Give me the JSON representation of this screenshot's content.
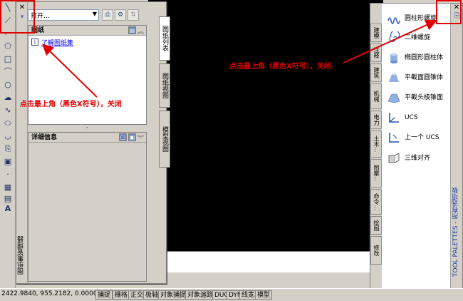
{
  "sheet_set_manager": {
    "title": "图纸集管理器",
    "open_combo": "打开...",
    "sheets_header": "图纸",
    "learn_link": "了解图纸集",
    "details_header": "详细信息",
    "tabs": [
      "图纸列表",
      "图纸视图",
      "模型视图"
    ]
  },
  "tool_palette": {
    "title": "TOOL PALETTES - 所有选项板",
    "tabs": [
      "建模",
      "注释",
      "建筑",
      "机械",
      "电力",
      "土木...",
      "图案...",
      "命令...",
      "绘图",
      "修改"
    ],
    "items": [
      {
        "label": "圆柱形螺旋",
        "icon": "helix-icon"
      },
      {
        "label": "二维螺旋",
        "icon": "spiral-icon"
      },
      {
        "label": "椭圆形圆柱体",
        "icon": "elliptical-cylinder-icon"
      },
      {
        "label": "平截面圆锥体",
        "icon": "frustum-cone-icon"
      },
      {
        "label": "平截头棱锥面",
        "icon": "frustum-pyramid-icon"
      },
      {
        "label": "UCS",
        "icon": "ucs-icon"
      },
      {
        "label": "上一个 UCS",
        "icon": "ucs-previous-icon"
      },
      {
        "label": "三维对齐",
        "icon": "3d-align-icon"
      }
    ]
  },
  "annotations": {
    "left": "点击最上角（黑色X符号），关闭",
    "right": "点击最上角（黑色X符号），关闭",
    "color": "#e00000"
  },
  "statusbar": {
    "coords": "2422.9840, 955.2182, 0.0000",
    "buttons": [
      "捕捉",
      "栅格",
      "正交",
      "极轴",
      "对象捕捉",
      "对象追踪",
      "DUCS",
      "DYN",
      "线宽",
      "模型"
    ]
  }
}
